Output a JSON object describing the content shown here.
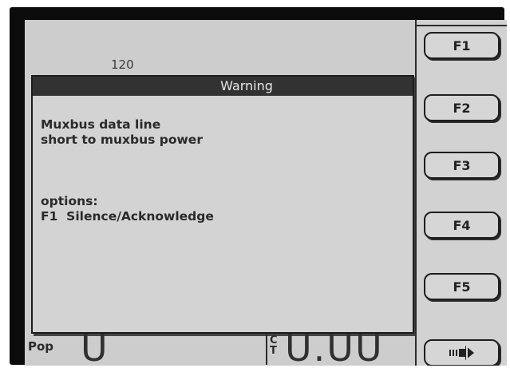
{
  "background": {
    "value_label": "120"
  },
  "dialog": {
    "title": "Warning",
    "message_line1": "Muxbus data line",
    "message_line2": "short to muxbus power",
    "options_heading": "options:",
    "option1": "F1  Silence/Acknowledge"
  },
  "function_keys": {
    "f1": "F1",
    "f2": "F2",
    "f3": "F3",
    "f4": "F4",
    "f5": "F5",
    "f6_icon": "next-page-arrow-icon"
  },
  "status_bar": {
    "pop_label": "Pop",
    "pop_value": "U",
    "ct_label": "CT",
    "ct_value": "U.UU"
  },
  "colors": {
    "screen_bg": "#cdcdcd",
    "title_bar_bg": "#323232",
    "title_text": "#e6e6e6",
    "text": "#262626"
  }
}
